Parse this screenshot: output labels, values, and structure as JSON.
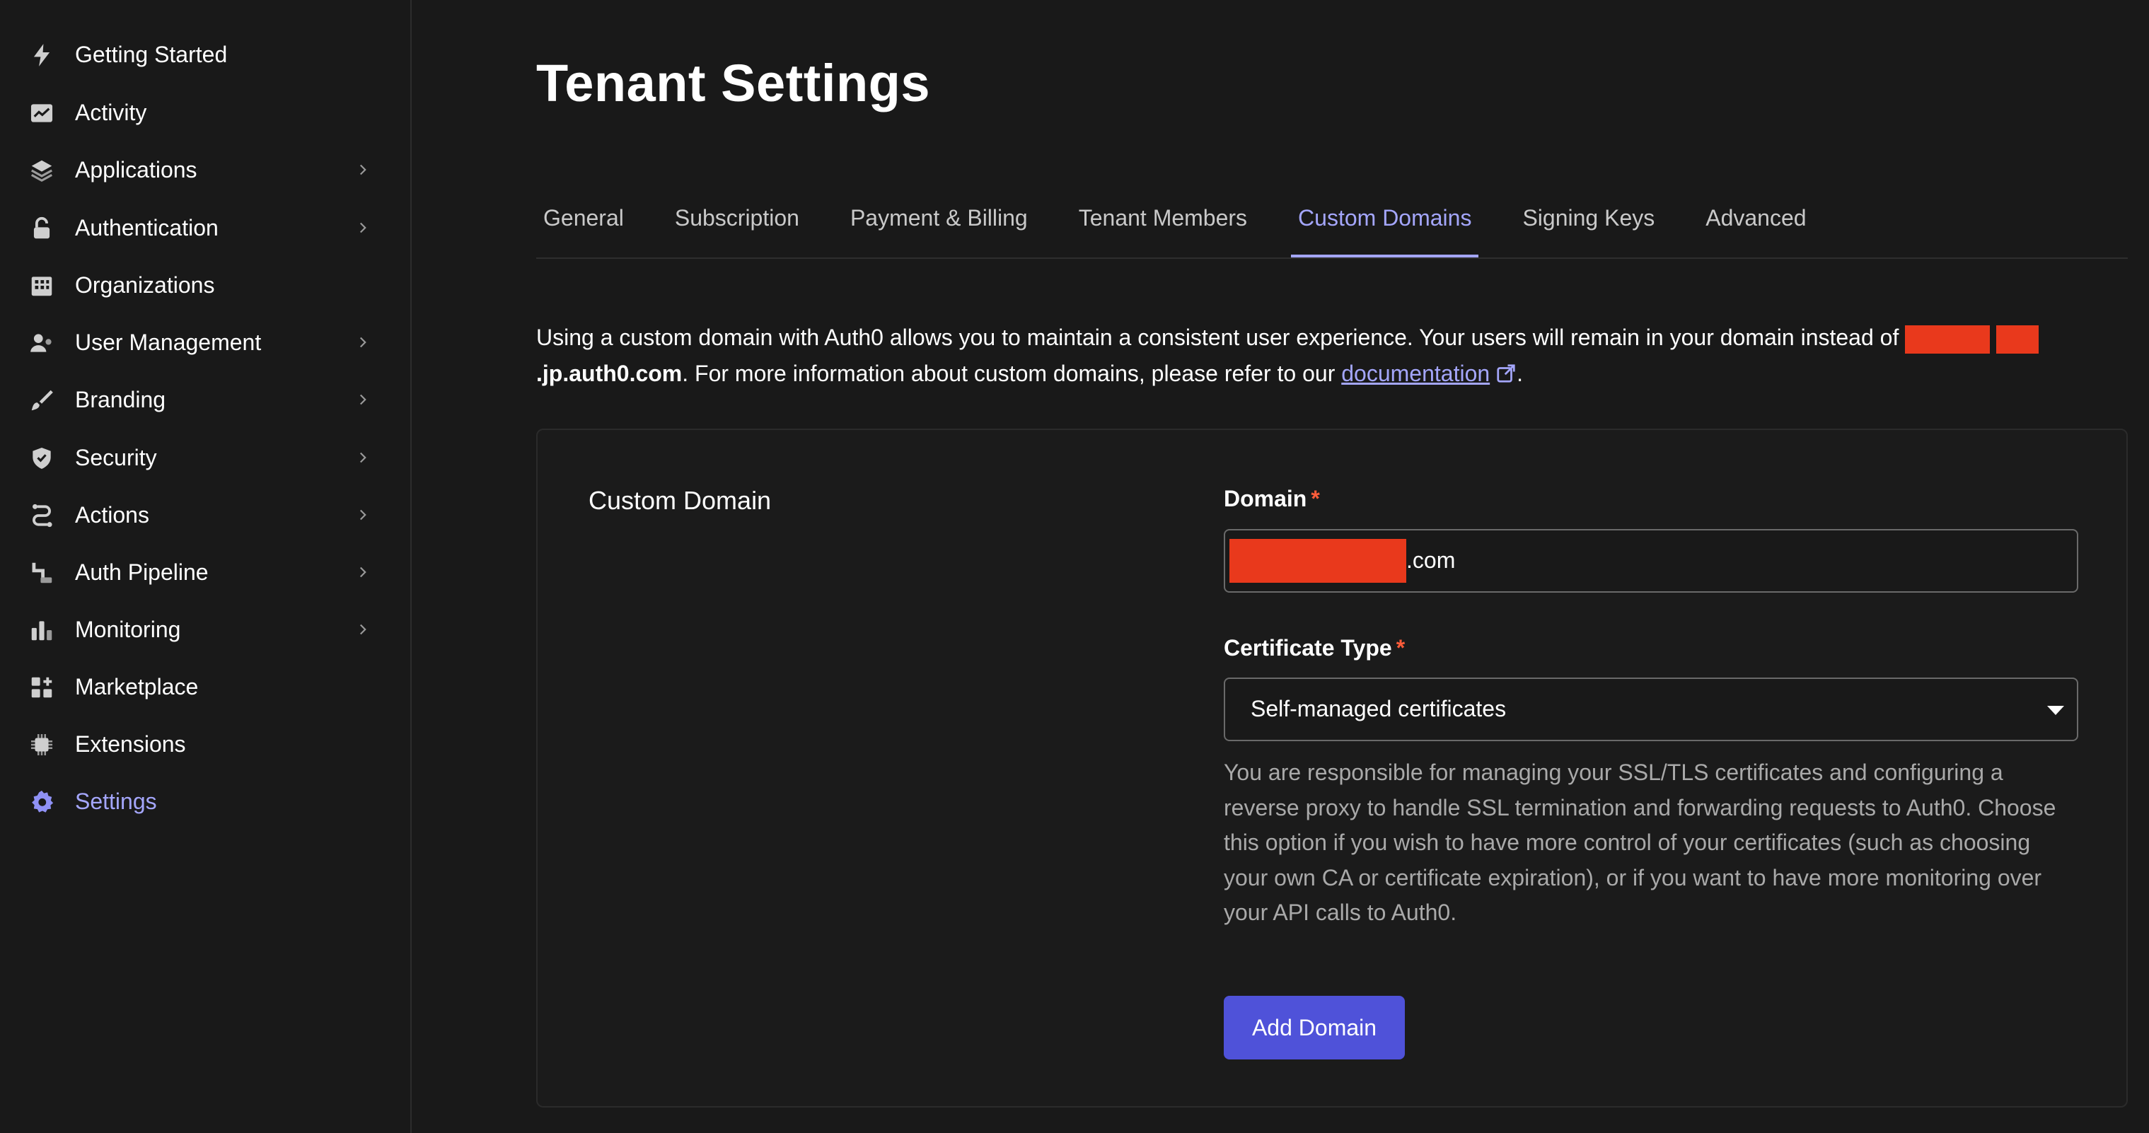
{
  "sidebar": {
    "items": [
      {
        "label": "Getting Started",
        "icon": "bolt-icon",
        "chevron": false
      },
      {
        "label": "Activity",
        "icon": "activity-chart-icon",
        "chevron": false
      },
      {
        "label": "Applications",
        "icon": "layers-icon",
        "chevron": true
      },
      {
        "label": "Authentication",
        "icon": "lock-icon",
        "chevron": true
      },
      {
        "label": "Organizations",
        "icon": "building-icon",
        "chevron": false
      },
      {
        "label": "User Management",
        "icon": "users-icon",
        "chevron": true
      },
      {
        "label": "Branding",
        "icon": "brush-icon",
        "chevron": true
      },
      {
        "label": "Security",
        "icon": "shield-check-icon",
        "chevron": true
      },
      {
        "label": "Actions",
        "icon": "actions-flow-icon",
        "chevron": true
      },
      {
        "label": "Auth Pipeline",
        "icon": "pipeline-icon",
        "chevron": true
      },
      {
        "label": "Monitoring",
        "icon": "bar-chart-icon",
        "chevron": true
      },
      {
        "label": "Marketplace",
        "icon": "marketplace-grid-icon",
        "chevron": false
      },
      {
        "label": "Extensions",
        "icon": "chip-icon",
        "chevron": false
      },
      {
        "label": "Settings",
        "icon": "gear-icon",
        "chevron": false,
        "active": true
      }
    ]
  },
  "page": {
    "title": "Tenant Settings",
    "tabs": [
      {
        "label": "General"
      },
      {
        "label": "Subscription"
      },
      {
        "label": "Payment & Billing"
      },
      {
        "label": "Tenant Members"
      },
      {
        "label": "Custom Domains",
        "active": true
      },
      {
        "label": "Signing Keys"
      },
      {
        "label": "Advanced"
      }
    ],
    "intro": {
      "text_1": "Using a custom domain with Auth0 allows you to maintain a consistent user experience. Your users will remain in your domain instead of ",
      "domain_suffix": ".jp.auth0.com",
      "text_2": ". For more information about custom domains, please refer to our ",
      "link_label": "documentation",
      "text_3": "."
    }
  },
  "card": {
    "title": "Custom Domain",
    "domain_label": "Domain",
    "domain_value_suffix": ".com",
    "certificate_label": "Certificate Type",
    "required_marker": "*",
    "certificate_selected": "Self-managed certificates",
    "help_text": "You are responsible for managing your SSL/TLS certificates and configuring a reverse proxy to handle SSL termination and forwarding requests to Auth0. Choose this option if you wish to have more control of your certificates (such as choosing your own CA or certificate expiration), or if you want to have more monitoring over your API calls to Auth0.",
    "add_button": "Add Domain"
  },
  "colors": {
    "background": "#191919",
    "accent": "#a4a6fb",
    "primary_button": "#4f52d9",
    "redaction": "#e9391c",
    "required": "#ff5c3a"
  }
}
